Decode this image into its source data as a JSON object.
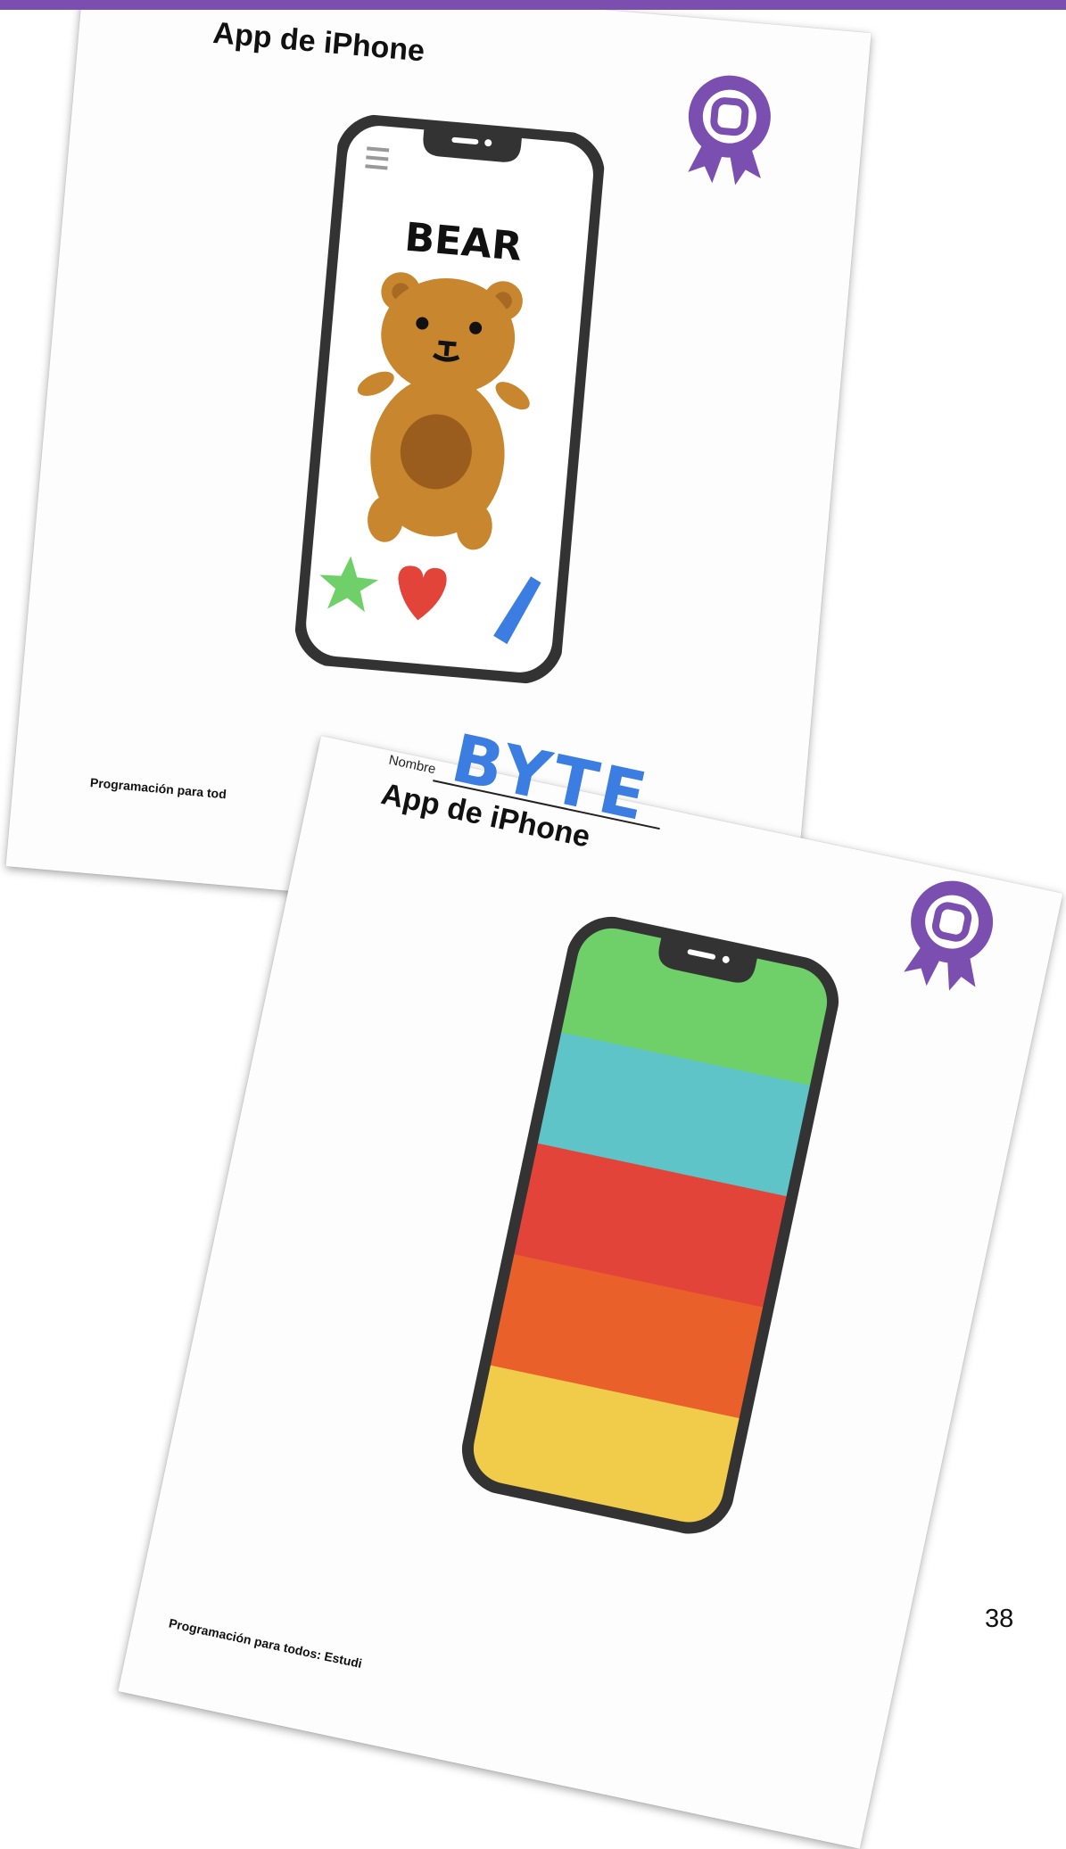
{
  "page_number": "38",
  "colors": {
    "brand_purple": "#7a4fb0",
    "crayon_blue": "#3b7de0"
  },
  "back_sheet": {
    "title": "App de iPhone",
    "footer": "Programación para tod",
    "screen_word": "BEAR",
    "icons": [
      "award-ribbon-icon",
      "bear-drawing",
      "star-icon",
      "heart-icon",
      "crayon-icon"
    ]
  },
  "front_sheet": {
    "name_label": "Nombre",
    "name_value": "BYTE",
    "title": "App de iPhone",
    "footer": "Programación para todos: Estudi",
    "stripe_colors": [
      "#6fd06a",
      "#5ec4c8",
      "#e2443a",
      "#e9602a",
      "#f0cc4a"
    ]
  }
}
